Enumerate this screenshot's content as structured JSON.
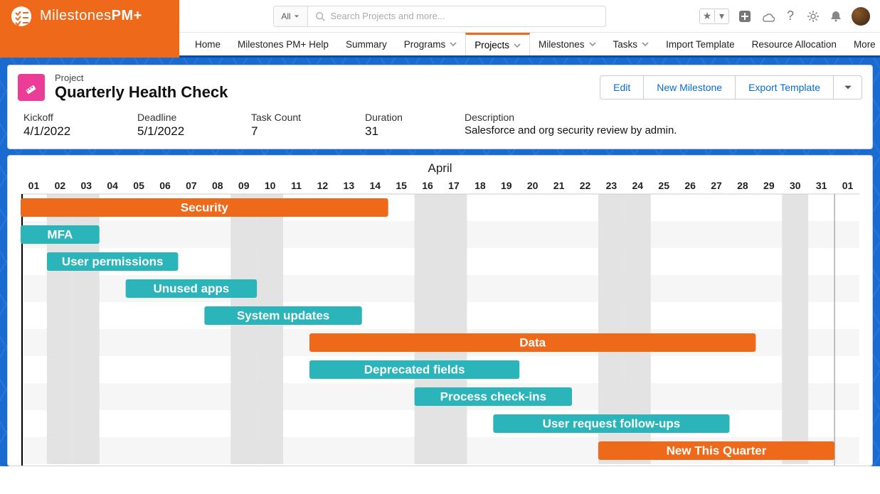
{
  "brand": {
    "name_a": "Milestones",
    "name_b": "PM+"
  },
  "search": {
    "scope": "All",
    "placeholder": "Search Projects and more..."
  },
  "nav": {
    "items": [
      {
        "label": "Home",
        "dd": false
      },
      {
        "label": "Milestones PM+ Help",
        "dd": false
      },
      {
        "label": "Summary",
        "dd": false
      },
      {
        "label": "Programs",
        "dd": true
      },
      {
        "label": "Projects",
        "dd": true,
        "active": true
      },
      {
        "label": "Milestones",
        "dd": true
      },
      {
        "label": "Tasks",
        "dd": true
      },
      {
        "label": "Import Template",
        "dd": false
      },
      {
        "label": "Resource Allocation",
        "dd": false
      },
      {
        "label": "More",
        "dd": true
      }
    ]
  },
  "project": {
    "kicker": "Project",
    "title": "Quarterly Health Check",
    "actions": {
      "edit": "Edit",
      "new_milestone": "New Milestone",
      "export": "Export Template"
    },
    "meta": {
      "kickoff": {
        "label": "Kickoff",
        "value": "4/1/2022"
      },
      "deadline": {
        "label": "Deadline",
        "value": "5/1/2022"
      },
      "taskcount": {
        "label": "Task Count",
        "value": "7"
      },
      "duration": {
        "label": "Duration",
        "value": "31"
      },
      "desc": {
        "label": "Description",
        "value": "Salesforce and org security review by admin."
      }
    }
  },
  "gantt": {
    "month": "April",
    "colors": {
      "group": "#ee6a1a",
      "task": "#2bb5ba"
    },
    "days": 31,
    "today": 1,
    "weekends": [
      2,
      3,
      9,
      10,
      16,
      17,
      23,
      24,
      30
    ],
    "rows": [
      {
        "label": "Security",
        "type": "group",
        "start": 1,
        "end": 14
      },
      {
        "label": "MFA",
        "type": "task",
        "start": 1,
        "end": 3
      },
      {
        "label": "User permissions",
        "type": "task",
        "start": 2,
        "end": 6
      },
      {
        "label": "Unused apps",
        "type": "task",
        "start": 5,
        "end": 9
      },
      {
        "label": "System updates",
        "type": "task",
        "start": 8,
        "end": 13
      },
      {
        "label": "Data",
        "type": "group",
        "start": 12,
        "end": 28
      },
      {
        "label": "Deprecated fields",
        "type": "task",
        "start": 12,
        "end": 19
      },
      {
        "label": "Process check-ins",
        "type": "task",
        "start": 16,
        "end": 21
      },
      {
        "label": "User request follow-ups",
        "type": "task",
        "start": 19,
        "end": 27
      },
      {
        "label": "New This Quarter",
        "type": "group",
        "start": 23,
        "end": 31
      }
    ]
  }
}
